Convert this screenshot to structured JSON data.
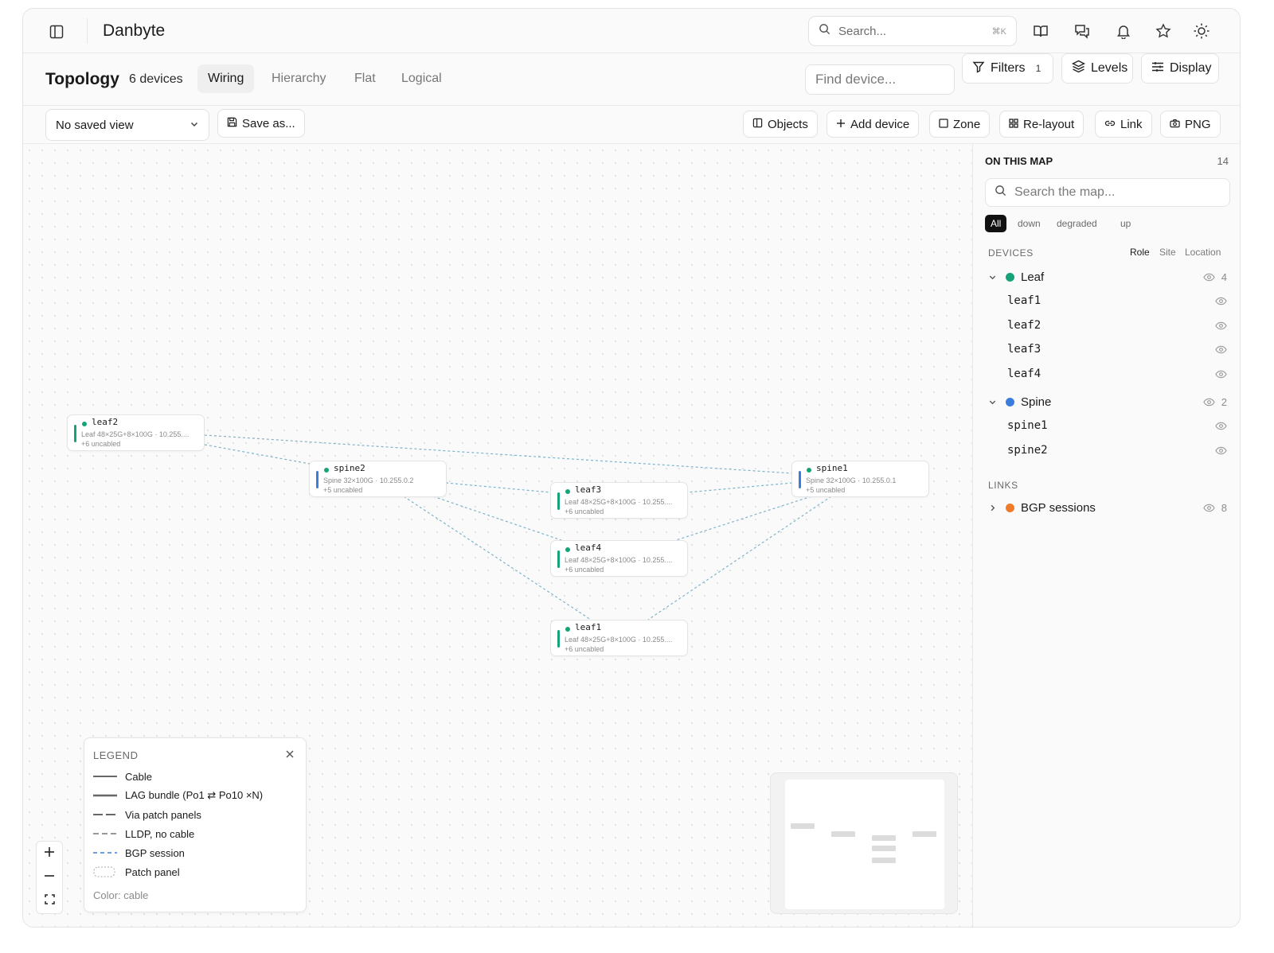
{
  "app": {
    "title": "Danbyte"
  },
  "search": {
    "placeholder": "Search...",
    "shortcut": "⌘K"
  },
  "page": {
    "title": "Topology",
    "device_count": "6 devices",
    "tabs": [
      {
        "label": "Wiring",
        "active": true
      },
      {
        "label": "Hierarchy",
        "active": false
      },
      {
        "label": "Flat",
        "active": false
      },
      {
        "label": "Logical",
        "active": false
      }
    ],
    "find_placeholder": "Find device...",
    "filters_label": "Filters",
    "filters_count": "1",
    "levels_label": "Levels",
    "display_label": "Display"
  },
  "toolbar": {
    "saved_view": "No saved view",
    "save_as": "Save as...",
    "objects": "Objects",
    "add_device": "Add device",
    "zone": "Zone",
    "relayout": "Re-layout",
    "link": "Link",
    "png": "PNG"
  },
  "nodes": [
    {
      "name": "leaf2",
      "detail": "Leaf 48×25G+8×100G · 10.255....",
      "extra": "+6 uncabled",
      "role": "leaf"
    },
    {
      "name": "spine2",
      "detail": "Spine 32×100G · 10.255.0.2",
      "extra": "+5 uncabled",
      "role": "spine"
    },
    {
      "name": "leaf3",
      "detail": "Leaf 48×25G+8×100G · 10.255....",
      "extra": "+6 uncabled",
      "role": "leaf"
    },
    {
      "name": "spine1",
      "detail": "Spine 32×100G · 10.255.0.1",
      "extra": "+5 uncabled",
      "role": "spine"
    },
    {
      "name": "leaf4",
      "detail": "Leaf 48×25G+8×100G · 10.255....",
      "extra": "+6 uncabled",
      "role": "leaf"
    },
    {
      "name": "leaf1",
      "detail": "Leaf 48×25G+8×100G · 10.255....",
      "extra": "+6 uncabled",
      "role": "leaf"
    }
  ],
  "legend": {
    "title": "LEGEND",
    "items": [
      {
        "label": "Cable"
      },
      {
        "label": "LAG bundle (Po1 ⇄ Po10 ×N)"
      },
      {
        "label": "Via patch panels"
      },
      {
        "label": "LLDP, no cable"
      },
      {
        "label": "BGP session"
      },
      {
        "label": "Patch panel"
      }
    ],
    "footer": "Color: cable"
  },
  "sidepanel": {
    "title": "ON THIS MAP",
    "count": "14",
    "search_placeholder": "Search the map...",
    "filters": [
      {
        "label": "All",
        "active": true
      },
      {
        "label": "down",
        "active": false
      },
      {
        "label": "degraded",
        "active": false
      },
      {
        "label": "up",
        "active": false
      }
    ],
    "devices_label": "DEVICES",
    "group_tabs": [
      {
        "label": "Role",
        "active": true
      },
      {
        "label": "Site",
        "active": false
      },
      {
        "label": "Location",
        "active": false
      }
    ],
    "groups": [
      {
        "name": "Leaf",
        "count": "4",
        "items": [
          "leaf1",
          "leaf2",
          "leaf3",
          "leaf4"
        ]
      },
      {
        "name": "Spine",
        "count": "2",
        "items": [
          "spine1",
          "spine2"
        ]
      }
    ],
    "links_label": "LINKS",
    "links": [
      {
        "name": "BGP sessions",
        "count": "8"
      }
    ]
  },
  "colors": {
    "leaf": "#16a37a",
    "spine": "#3b7ddd",
    "bgp": "#ef7a2a",
    "link_line": "#7fb3c9"
  },
  "icons": [
    "sidebar-toggle-icon",
    "search-icon",
    "book-icon",
    "chat-icon",
    "bell-icon",
    "star-icon",
    "sun-icon",
    "filter-icon",
    "layers-icon",
    "sliders-icon",
    "chevron-down-icon",
    "save-icon",
    "panel-icon",
    "plus-icon",
    "square-icon",
    "grid-icon",
    "link-icon",
    "camera-icon",
    "close-icon",
    "minus-icon",
    "fullscreen-icon",
    "eye-icon",
    "chevron-right-icon"
  ]
}
